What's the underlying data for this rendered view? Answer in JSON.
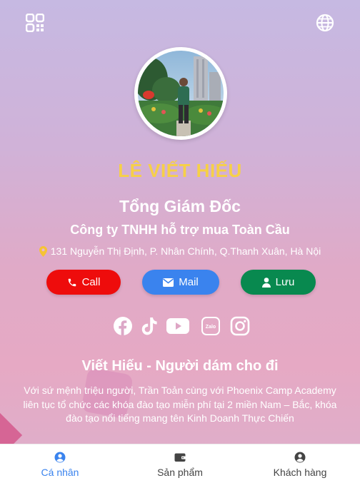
{
  "profile": {
    "name": "LÊ VIẾT HIẾU",
    "title": "Tổng Giám Đốc",
    "company": "Công ty TNHH hỗ trợ mua Toàn Cầu",
    "address": "131 Nguyễn Thị Định, P. Nhân Chính, Q.Thanh Xuân, Hà Nội"
  },
  "actions": {
    "call": "Call",
    "mail": "Mail",
    "save": "Lưu"
  },
  "socials": [
    "facebook-icon",
    "tiktok-icon",
    "youtube-icon",
    "zalo-icon",
    "instagram-icon"
  ],
  "about": {
    "heading": "Viết Hiếu - Người dám cho đi",
    "text": "Với sứ mệnh triệu người, Trần Toản cùng với Phoenix Camp Academy liên tục tổ chức các khóa đào tạo miễn phí tại 2 miền Nam – Bắc, khóa đào tạo nổi tiếng mang tên Kinh Doanh Thực Chiến"
  },
  "zalo_label": "Zalo",
  "tabs": [
    {
      "label": "Cá nhân",
      "icon": "user-circle-icon",
      "active": true
    },
    {
      "label": "Sản phẩm",
      "icon": "wallet-icon",
      "active": false
    },
    {
      "label": "Khách hàng",
      "icon": "user-circle-icon",
      "active": false
    }
  ],
  "colors": {
    "name": "#f6d047",
    "call": "#ee0c0c",
    "mail": "#3a83ee",
    "save": "#08894f",
    "active_tab": "#3a83ee"
  }
}
